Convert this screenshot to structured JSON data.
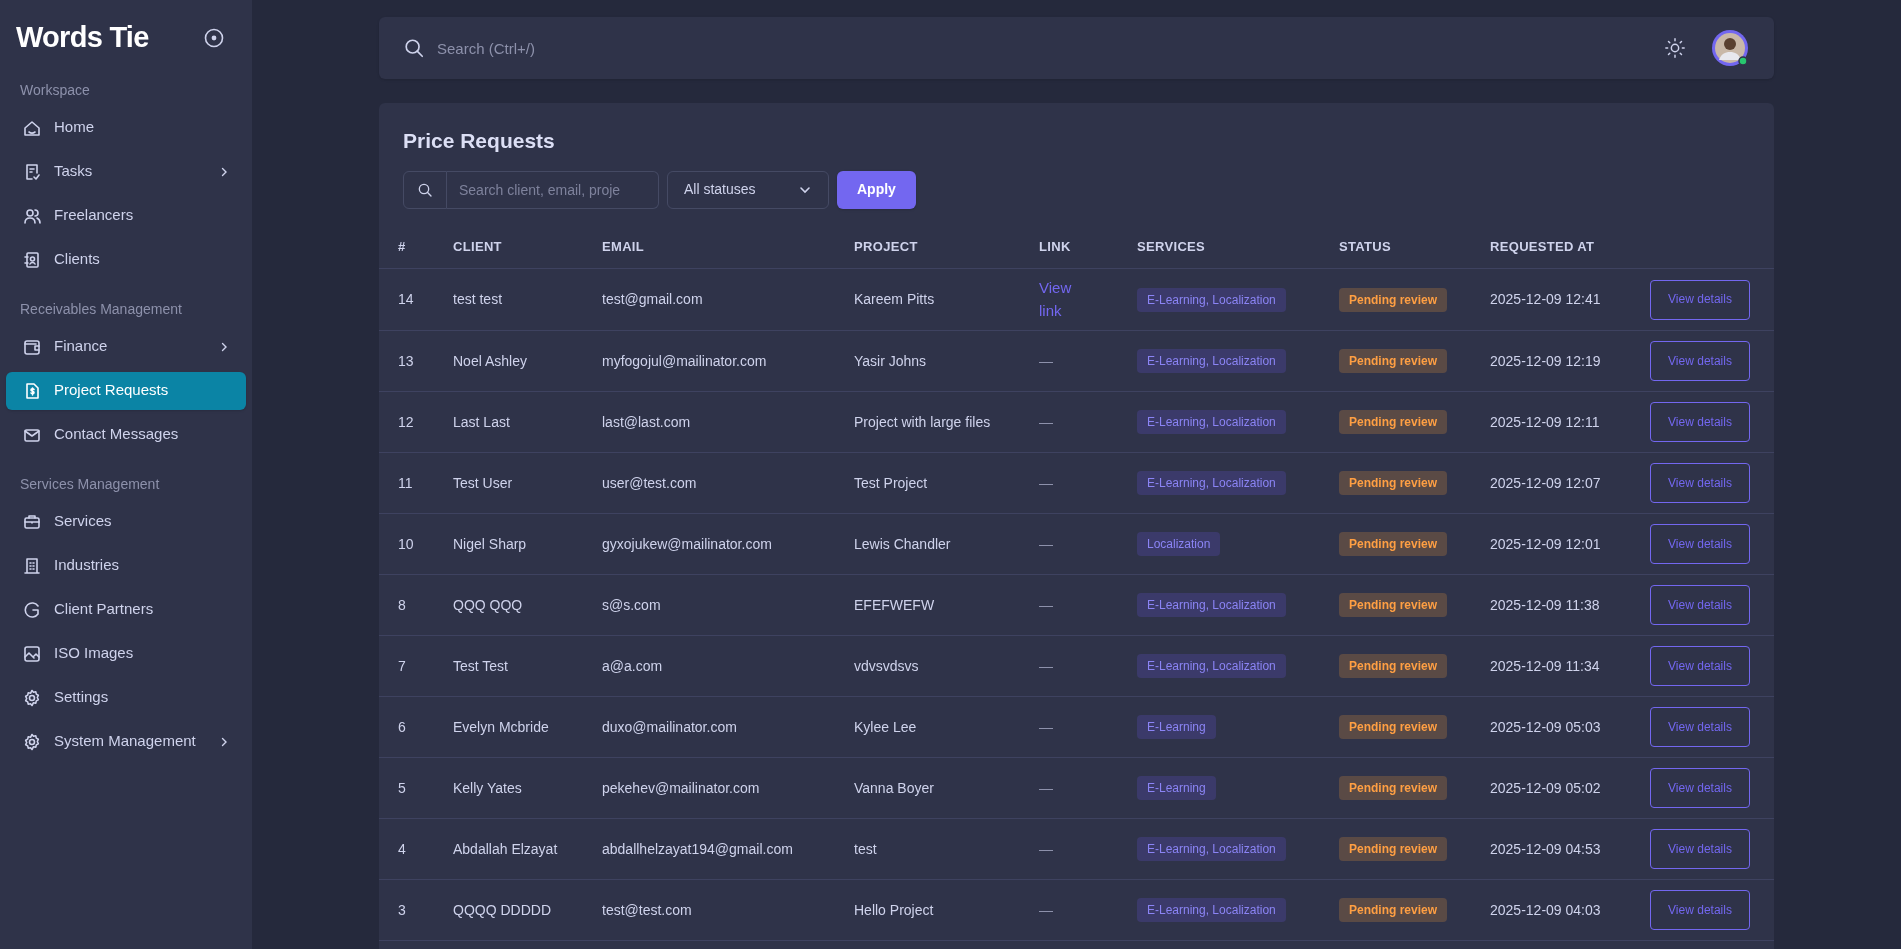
{
  "sidebar": {
    "logo": "Words Tie",
    "sections": [
      {
        "title": "Workspace",
        "items": [
          {
            "label": "Home",
            "has_submenu": false,
            "selected": false
          },
          {
            "label": "Tasks",
            "has_submenu": true,
            "selected": false
          },
          {
            "label": "Freelancers",
            "has_submenu": false,
            "selected": false
          },
          {
            "label": "Clients",
            "has_submenu": false,
            "selected": false
          }
        ]
      },
      {
        "title": "Receivables Management",
        "items": [
          {
            "label": "Finance",
            "has_submenu": true,
            "selected": false
          },
          {
            "label": "Project Requests",
            "has_submenu": false,
            "selected": true
          },
          {
            "label": "Contact Messages",
            "has_submenu": false,
            "selected": false
          }
        ]
      },
      {
        "title": "Services Management",
        "items": [
          {
            "label": "Services",
            "has_submenu": false,
            "selected": false
          },
          {
            "label": "Industries",
            "has_submenu": false,
            "selected": false
          },
          {
            "label": "Client Partners",
            "has_submenu": false,
            "selected": false
          },
          {
            "label": "ISO Images",
            "has_submenu": false,
            "selected": false
          },
          {
            "label": "Settings",
            "has_submenu": false,
            "selected": false
          },
          {
            "label": "System Management",
            "has_submenu": true,
            "selected": false
          }
        ]
      }
    ]
  },
  "topbar": {
    "search": {
      "placeholder": "Search (Ctrl+/)"
    }
  },
  "page": {
    "title": "Price Requests",
    "filter_search": {
      "placeholder": "Search client, email, proje"
    },
    "status_select": "All statuses",
    "apply_button": "Apply"
  },
  "table": {
    "columns": [
      "#",
      "CLIENT",
      "EMAIL",
      "PROJECT",
      "LINK",
      "SERVICES",
      "STATUS",
      "REQUESTED AT"
    ],
    "rows": [
      {
        "id": "14",
        "client": "test test",
        "email": "test@gmail.com",
        "project": "Kareem Pitts",
        "link": "View link",
        "services": "E-Learning, Localization",
        "status": "Pending review",
        "requested_at": "2025-12-09 12:41",
        "action": "View details"
      },
      {
        "id": "13",
        "client": "Noel Ashley",
        "email": "myfogojul@mailinator.com",
        "project": "Yasir Johns",
        "link": "—",
        "services": "E-Learning, Localization",
        "status": "Pending review",
        "requested_at": "2025-12-09 12:19",
        "action": "View details"
      },
      {
        "id": "12",
        "client": "Last Last",
        "email": "last@last.com",
        "project": "Project with large files",
        "link": "—",
        "services": "E-Learning, Localization",
        "status": "Pending review",
        "requested_at": "2025-12-09 12:11",
        "action": "View details"
      },
      {
        "id": "11",
        "client": "Test User",
        "email": "user@test.com",
        "project": "Test Project",
        "link": "—",
        "services": "E-Learning, Localization",
        "status": "Pending review",
        "requested_at": "2025-12-09 12:07",
        "action": "View details"
      },
      {
        "id": "10",
        "client": "Nigel Sharp",
        "email": "gyxojukew@mailinator.com",
        "project": "Lewis Chandler",
        "link": "—",
        "services": "Localization",
        "status": "Pending review",
        "requested_at": "2025-12-09 12:01",
        "action": "View details"
      },
      {
        "id": "8",
        "client": "QQQ QQQ",
        "email": "s@s.com",
        "project": "EFEFWEFW",
        "link": "—",
        "services": "E-Learning, Localization",
        "status": "Pending review",
        "requested_at": "2025-12-09 11:38",
        "action": "View details"
      },
      {
        "id": "7",
        "client": "Test Test",
        "email": "a@a.com",
        "project": "vdvsvdsvs",
        "link": "—",
        "services": "E-Learning, Localization",
        "status": "Pending review",
        "requested_at": "2025-12-09 11:34",
        "action": "View details"
      },
      {
        "id": "6",
        "client": "Evelyn Mcbride",
        "email": "duxo@mailinator.com",
        "project": "Kylee Lee",
        "link": "—",
        "services": "E-Learning",
        "status": "Pending review",
        "requested_at": "2025-12-09 05:03",
        "action": "View details"
      },
      {
        "id": "5",
        "client": "Kelly Yates",
        "email": "pekehev@mailinator.com",
        "project": "Vanna Boyer",
        "link": "—",
        "services": "E-Learning",
        "status": "Pending review",
        "requested_at": "2025-12-09 05:02",
        "action": "View details"
      },
      {
        "id": "4",
        "client": "Abdallah Elzayat",
        "email": "abdallhelzayat194@gmail.com",
        "project": "test",
        "link": "—",
        "services": "E-Learning, Localization",
        "status": "Pending review",
        "requested_at": "2025-12-09 04:53",
        "action": "View details"
      },
      {
        "id": "3",
        "client": "QQQQ DDDDD",
        "email": "test@test.com",
        "project": "Hello Project",
        "link": "—",
        "services": "E-Learning, Localization",
        "status": "Pending review",
        "requested_at": "2025-12-09 04:03",
        "action": "View details"
      }
    ]
  }
}
